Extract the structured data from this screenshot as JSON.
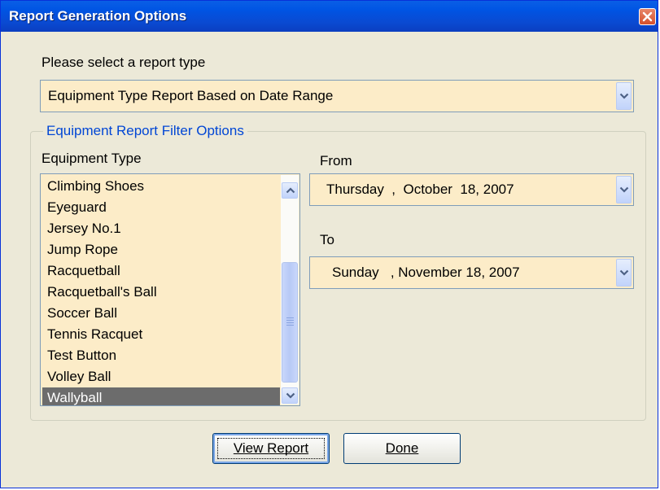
{
  "window": {
    "title": "Report Generation Options"
  },
  "report_type": {
    "label": "Please select a report type",
    "selected": "Equipment Type Report Based on Date Range"
  },
  "filter": {
    "legend": "Equipment Report Filter Options",
    "equipment_label": "Equipment Type",
    "equipment_items": [
      "Climbing Shoes",
      "Eyeguard",
      "Jersey No.1",
      "Jump Rope",
      "Racquetball",
      "Racquetball's Ball",
      "Soccer Ball",
      "Tennis Racquet",
      "Test Button",
      "Volley Ball",
      "Wallyball"
    ],
    "selected_item": "Wallyball",
    "from_label": "From",
    "from_date": "Thursday  ,  October  18, 2007",
    "to_label": "To",
    "to_date": "Sunday   , November 18, 2007"
  },
  "buttons": {
    "view_report": "View Report",
    "done": "Done"
  },
  "icons": {
    "close": "close-icon",
    "dropdown": "chevron-down-icon",
    "scroll_up": "chevron-up-icon",
    "scroll_down": "chevron-down-icon"
  },
  "colors": {
    "titlebar": "#0054e3",
    "field_bg": "#fcecc8",
    "dialog_bg": "#ece9d8",
    "selection": "#6c6c6c",
    "legend": "#0046d5"
  }
}
